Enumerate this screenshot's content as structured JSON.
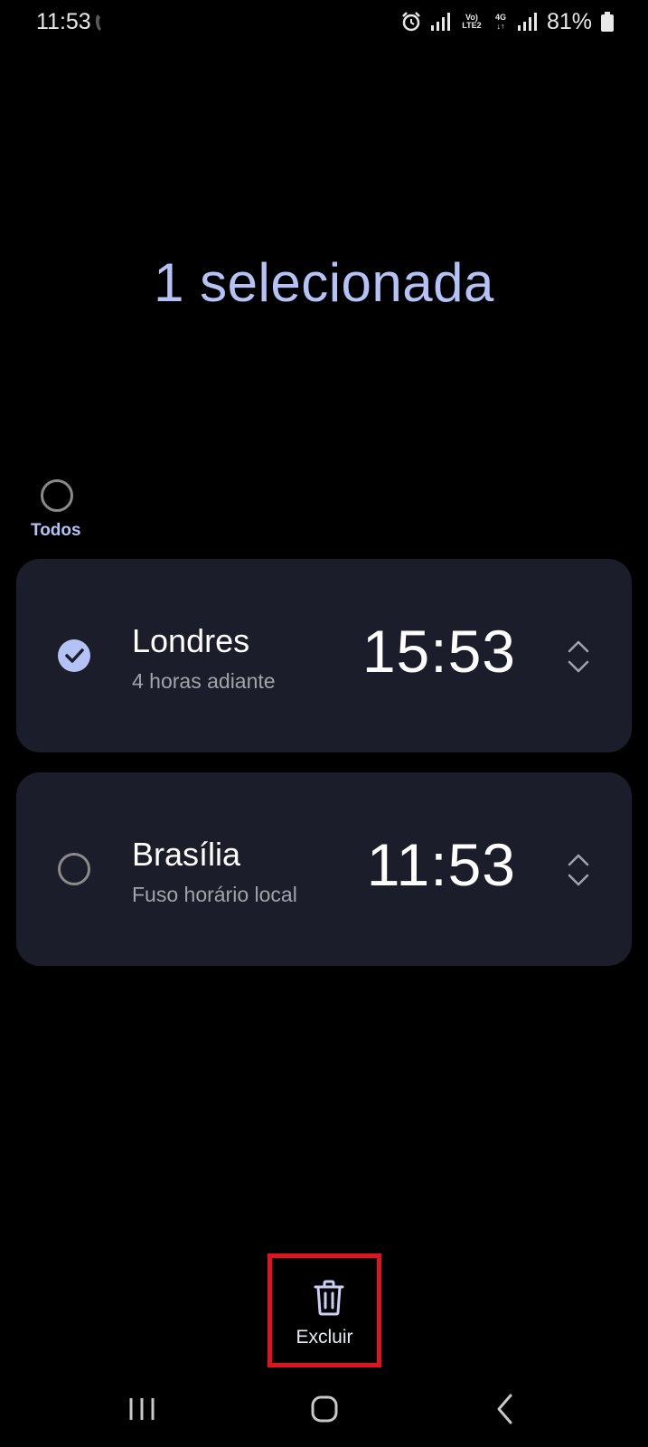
{
  "status_bar": {
    "time": "11:53",
    "lte_top": "Vo)",
    "lte_bottom": "LTE2",
    "network_type": "4G",
    "battery_percent": "81%",
    "icons": [
      "phone-call-icon",
      "alarm-icon",
      "signal-icon",
      "volte-icon",
      "network-4g-icon",
      "signal-icon",
      "battery-icon"
    ]
  },
  "header": {
    "title": "1 selecionada"
  },
  "select_all": {
    "label": "Todos",
    "checked": false
  },
  "clocks": [
    {
      "city": "Londres",
      "subtitle": "4 horas adiante",
      "time": "15:53",
      "selected": true
    },
    {
      "city": "Brasília",
      "subtitle": "Fuso horário local",
      "time": "11:53",
      "selected": false
    }
  ],
  "bottom_bar": {
    "delete_label": "Excluir",
    "highlight_color": "#e0141e"
  },
  "colors": {
    "accent": "#b4c2f5",
    "card_background": "#1c1d2a",
    "background": "#000000"
  }
}
